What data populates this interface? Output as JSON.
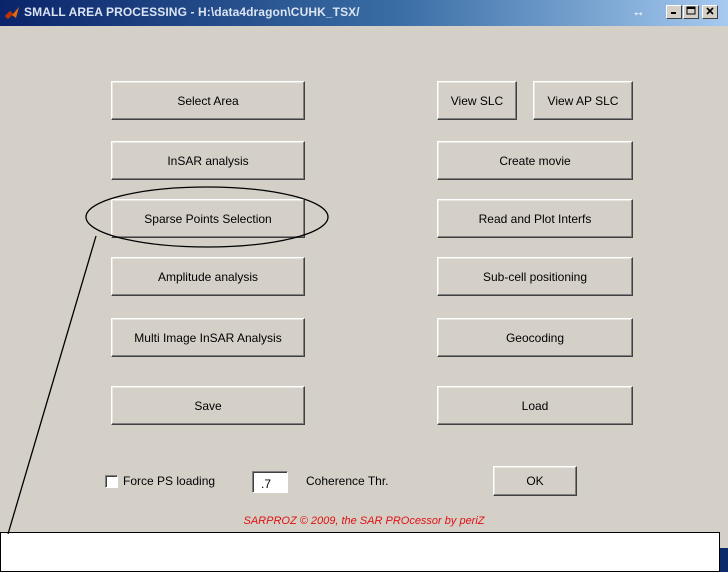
{
  "window": {
    "title": "SMALL AREA PROCESSING - H:\\data4dragon\\CUHK_TSX/",
    "resize_glyph": "↔"
  },
  "left_buttons": [
    {
      "label": "Select Area"
    },
    {
      "label": "InSAR analysis"
    },
    {
      "label": "Sparse Points Selection"
    },
    {
      "label": "Amplitude analysis"
    },
    {
      "label": "Multi Image InSAR Analysis"
    },
    {
      "label": "Save"
    }
  ],
  "right_buttons": {
    "view_slc": "View SLC",
    "view_ap_slc": "View AP SLC",
    "create_movie": "Create movie",
    "read_plot_interfs": "Read and Plot Interfs",
    "subcell": "Sub-cell positioning",
    "geocoding": "Geocoding",
    "load": "Load"
  },
  "options": {
    "force_ps_label": "Force PS loading",
    "force_ps_checked": false,
    "coherence_value": ".7",
    "coherence_label": "Coherence Thr.",
    "ok_label": "OK"
  },
  "footer": {
    "copyright": "SARPROZ © 2009, the SAR PROcessor by periZ"
  },
  "annotation": {
    "highlighted_button": "Sparse Points Selection"
  }
}
